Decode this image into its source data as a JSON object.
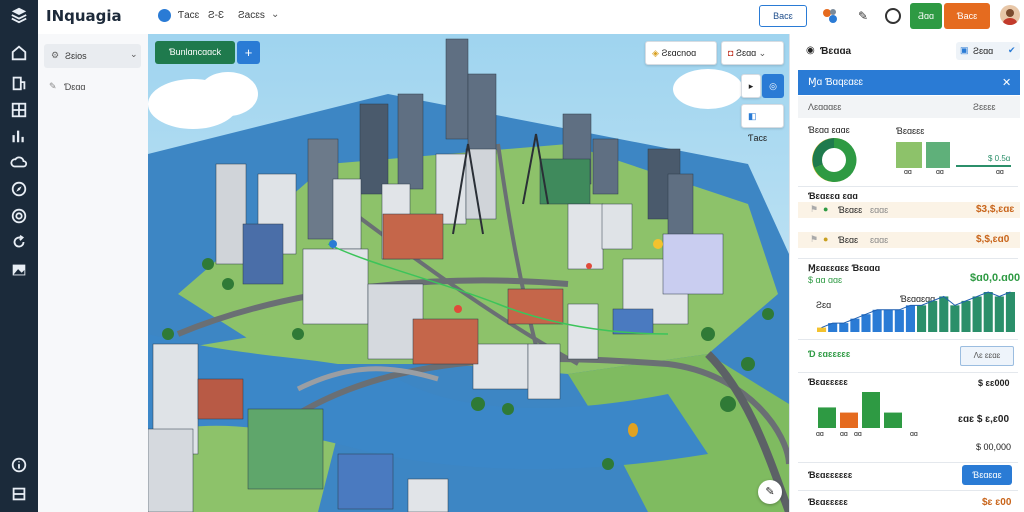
{
  "app": {
    "title": "INquagia"
  },
  "topbar": {
    "links": [
      "Ƭacɛ",
      "Ƨ-Ɛ",
      "Ƨacɛs"
    ],
    "btn_outline": "Bacɛ",
    "btn_green": "Ƌɑɑ",
    "btn_orange": "Ɓacɛ"
  },
  "subpanel": {
    "select_label": "Ƨɛios",
    "item_label": "Ɗɛɑɑ"
  },
  "map": {
    "primary_btn": "Ɓunlɑncɑɑck",
    "plus_btn": "+",
    "chip1": "Ƨɛɑcnoɑ",
    "chip2": "Ƨɛɑɑ",
    "layer_btn": "Ƭacɛ"
  },
  "rpanel": {
    "title": "Ɓɛɑɑa",
    "search": "Ƨɛɑɑ",
    "banner": "Ɱɑ Ɓɑqɛɑɛɛ",
    "sub_header_left": "Ʌɛɑɑɑɛɛ",
    "sub_header_right": "Ƨɛɛɛɛ",
    "gauge_label": "Ɓɛɑɑ ɛɑɑɛ",
    "mini_chart_label": "Ɓɛɑɛɛɛ",
    "mini_chart_value": "$ 0.5ɑ",
    "mini_ticks": [
      "ɑɑ",
      "ɑɑ",
      "ɑɑ"
    ],
    "sec2_title": "Ɓɛɑɛɛɑ ɛɑɑ",
    "sec2_rows": [
      {
        "label": "Ɓɛɑɛɛ",
        "sub": "ɛɑɑɛ",
        "value": "$3,$,ɛɑɛ"
      },
      {
        "label": "Ɓɛɑɛ",
        "sub": "ɛɑɑɛ",
        "value": "$,$,ɛɑ0"
      }
    ],
    "sec3_title": "Ɱɛɑɛɛɑɛɛ Ɓɛɑɑɑ",
    "sec3_sub": "$ ɑɑ ɑɑɛ",
    "sec3_value": "$ɑ0,0.ɑ00",
    "sec3_small": "Ƨɛɑ",
    "sec3_small_right": "Ɓɛɑɑɛɑɑ",
    "sec4_title": "Ɗ ɛɑɛɛɛɛɛ",
    "sec4_btn": "Ʌɛ ɛɛɑɛ",
    "sec5_title": "Ɓɛɑɛɛɛɛɛ",
    "sec5_value": "$ ɛɛ000",
    "sec5_value2": "ɛɑɛ $ ɛ,ɛ00",
    "sec5_value3": "$ 00,000",
    "sec5_ticks": [
      "ɑɑ",
      "ɑɑ",
      "ɑɑ",
      "ɑɑ"
    ],
    "sec6_title": "Ɓɛɑɛɛɛɛɛɛ",
    "sec6_btn": "Ɓɛɑɛɑɛ",
    "sec7_title": "Ɓɛɑɛɛɛɛɛ",
    "sec7_value": "$ɛ ɛ00"
  },
  "colors": {
    "rail": "#1b2a3a",
    "primary_blue": "#2a7bd5",
    "green": "#2e9a43",
    "orange": "#e56b1f",
    "teal": "#2b8f6a"
  },
  "chart_data": {
    "type": "bar",
    "values": [
      1,
      2,
      2,
      3,
      4,
      5,
      5,
      5,
      6,
      6,
      7,
      8,
      6,
      7,
      8,
      9,
      8,
      9
    ],
    "series2": [
      4,
      3,
      7,
      3,
      0
    ]
  }
}
